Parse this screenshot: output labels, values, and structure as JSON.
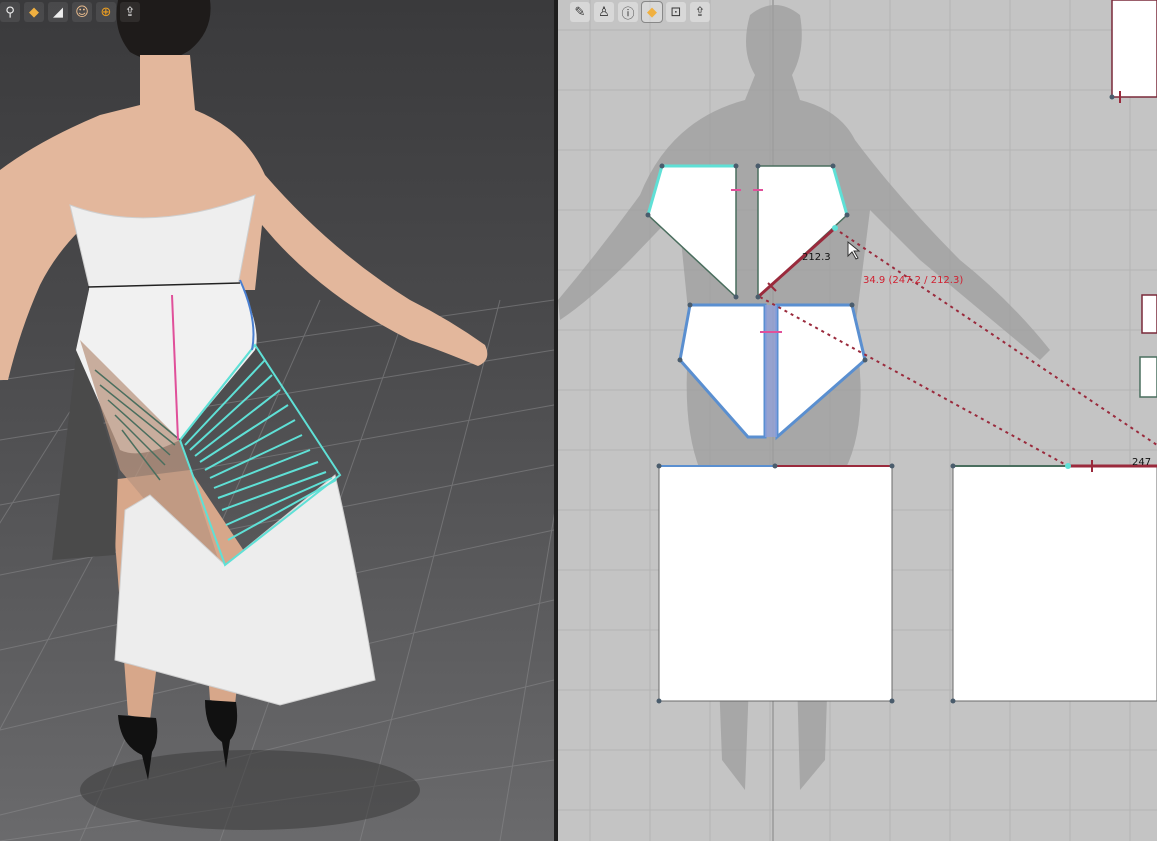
{
  "viewport_3d": {
    "toolbar": [
      {
        "name": "avatar-select-icon",
        "glyph": "⚲"
      },
      {
        "name": "garment-icon",
        "glyph": "◆"
      },
      {
        "name": "shoe-icon",
        "glyph": "◢"
      },
      {
        "name": "avatar-icon",
        "glyph": "☺"
      },
      {
        "name": "globe-icon",
        "glyph": "⊕"
      },
      {
        "name": "ruler-export-icon",
        "glyph": "⇪"
      }
    ]
  },
  "viewport_2d": {
    "toolbar": [
      {
        "name": "edit-pen-icon",
        "glyph": "✎"
      },
      {
        "name": "shirt-icon",
        "glyph": "♙"
      },
      {
        "name": "info-icon",
        "glyph": "ⓘ"
      },
      {
        "name": "garment-select-icon",
        "glyph": "◆",
        "active": true
      },
      {
        "name": "lock-shirt-icon",
        "glyph": "⊡"
      },
      {
        "name": "export-icon",
        "glyph": "⇪"
      }
    ],
    "measurements": {
      "segment_length": "212.3",
      "seam_ratio": "34.9 (247.2 / 212.3)",
      "edge_length": "247"
    }
  },
  "colors": {
    "seam_cyan": "#5fe0d6",
    "seam_red": "#9a2a3c",
    "seam_blue": "#5a8fd0",
    "seam_pink": "#e0509a",
    "pattern_fill": "#ffffff",
    "grid_bg": "#c4c4c4"
  }
}
